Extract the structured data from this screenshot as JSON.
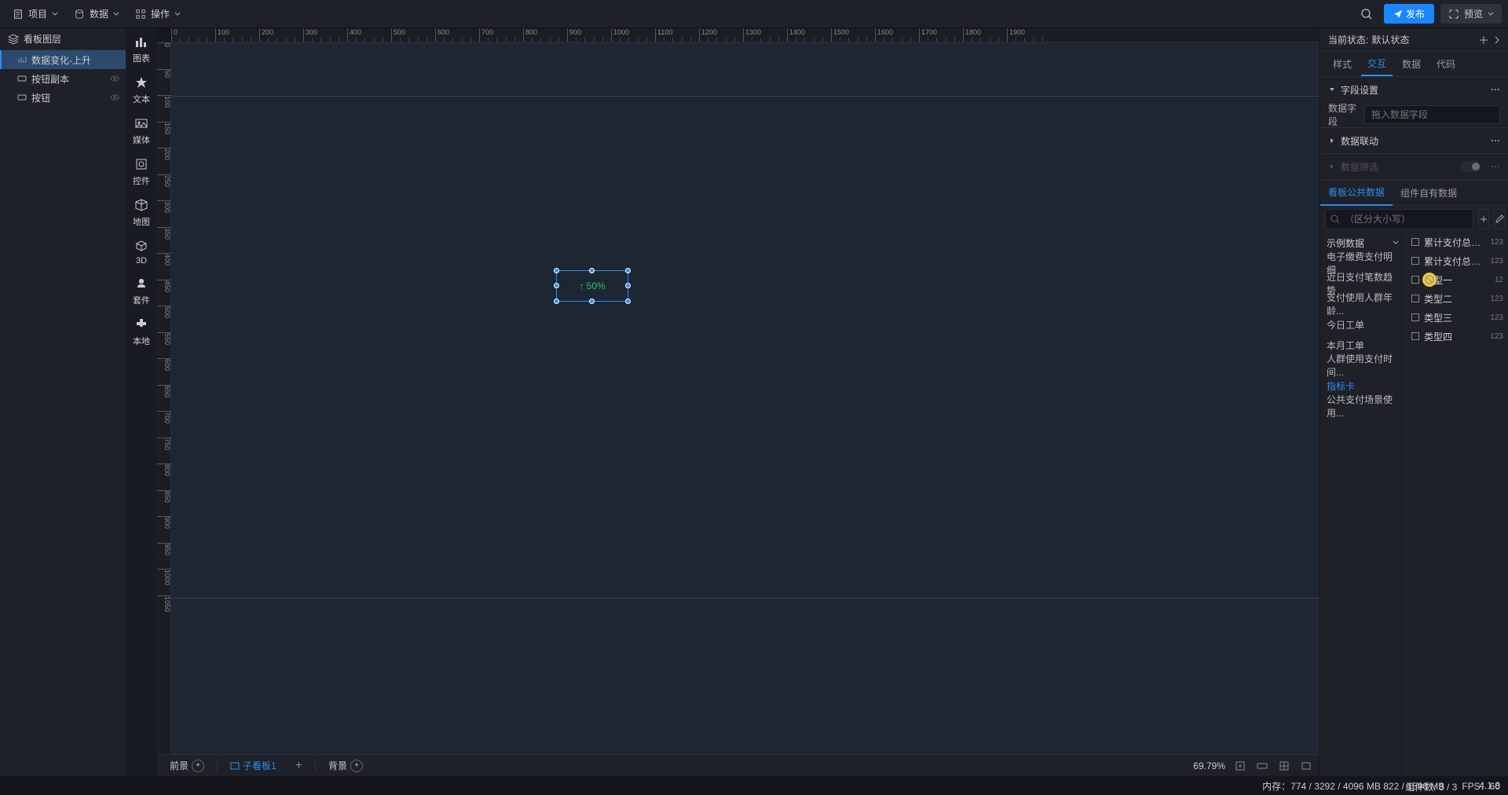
{
  "topbar": {
    "menus": [
      {
        "label": "项目"
      },
      {
        "label": "数据"
      },
      {
        "label": "操作"
      }
    ],
    "publish": "发布",
    "preview": "预览"
  },
  "hierarchy": {
    "title": "看板图层",
    "items": [
      {
        "label": "数据变化-上升",
        "selected": true
      },
      {
        "label": "按钮副本",
        "eye": true
      },
      {
        "label": "按钮",
        "eye": true
      }
    ]
  },
  "rail": [
    {
      "label": "图表"
    },
    {
      "label": "文本"
    },
    {
      "label": "媒体"
    },
    {
      "label": "控件"
    },
    {
      "label": "地图"
    },
    {
      "label": "3D"
    },
    {
      "label": "套件"
    },
    {
      "label": "本地"
    }
  ],
  "canvas": {
    "selected_text": "↑ 50%",
    "hticks": [
      0,
      100,
      200,
      300,
      400,
      500,
      600,
      700,
      800,
      900,
      1000,
      1100,
      1200,
      1300,
      1400,
      1500,
      1600,
      1700,
      1800,
      1900
    ],
    "vticks": [
      0,
      50,
      100,
      150,
      200,
      250,
      300,
      350,
      400,
      450,
      500,
      550,
      600,
      650,
      700,
      750,
      800,
      850,
      900,
      950,
      1000,
      1050
    ],
    "tabs": {
      "fore": "前景",
      "sub": "子看板1",
      "back": "背景"
    },
    "zoom": "69.79%"
  },
  "right": {
    "state_label": "当前状态:",
    "state_value": "默认状态",
    "tabs": [
      "样式",
      "交互",
      "数据",
      "代码"
    ],
    "active_tab": 1,
    "field_section": "字段设置",
    "field_row_label": "数据字段",
    "field_row_placeholder": "拖入数据字段",
    "link_section": "数据联动",
    "filter_section": "数据筛选"
  },
  "datasource": {
    "tabs": [
      "看板公共数据",
      "组件自有数据"
    ],
    "search_placeholder": "（区分大小写）",
    "tree": [
      {
        "label": "示例数据",
        "root": true
      },
      {
        "label": "电子缴费支付明细"
      },
      {
        "label": "近日支付笔数趋势"
      },
      {
        "label": "支付使用人群年龄..."
      },
      {
        "label": "今日工单"
      },
      {
        "label": "本月工单"
      },
      {
        "label": "人群使用支付时间..."
      },
      {
        "label": "指标卡",
        "active": true
      },
      {
        "label": "公共支付场景使用..."
      }
    ],
    "fields": [
      {
        "name": "累计支付总笔...",
        "type": "123"
      },
      {
        "name": "累计支付总金...",
        "type": "123"
      },
      {
        "name": "类型一",
        "type": "12",
        "cursor": true
      },
      {
        "name": "类型二",
        "type": "123"
      },
      {
        "name": "类型三",
        "type": "123"
      },
      {
        "name": "类型四",
        "type": "123"
      }
    ]
  },
  "footer": {
    "mem": "内存：774 / 3292 / 4096 MB  822 / 1596 MB",
    "fps": "FPS：60",
    "count": "组件数: 3 / 3",
    "ver": "4.1.8"
  }
}
